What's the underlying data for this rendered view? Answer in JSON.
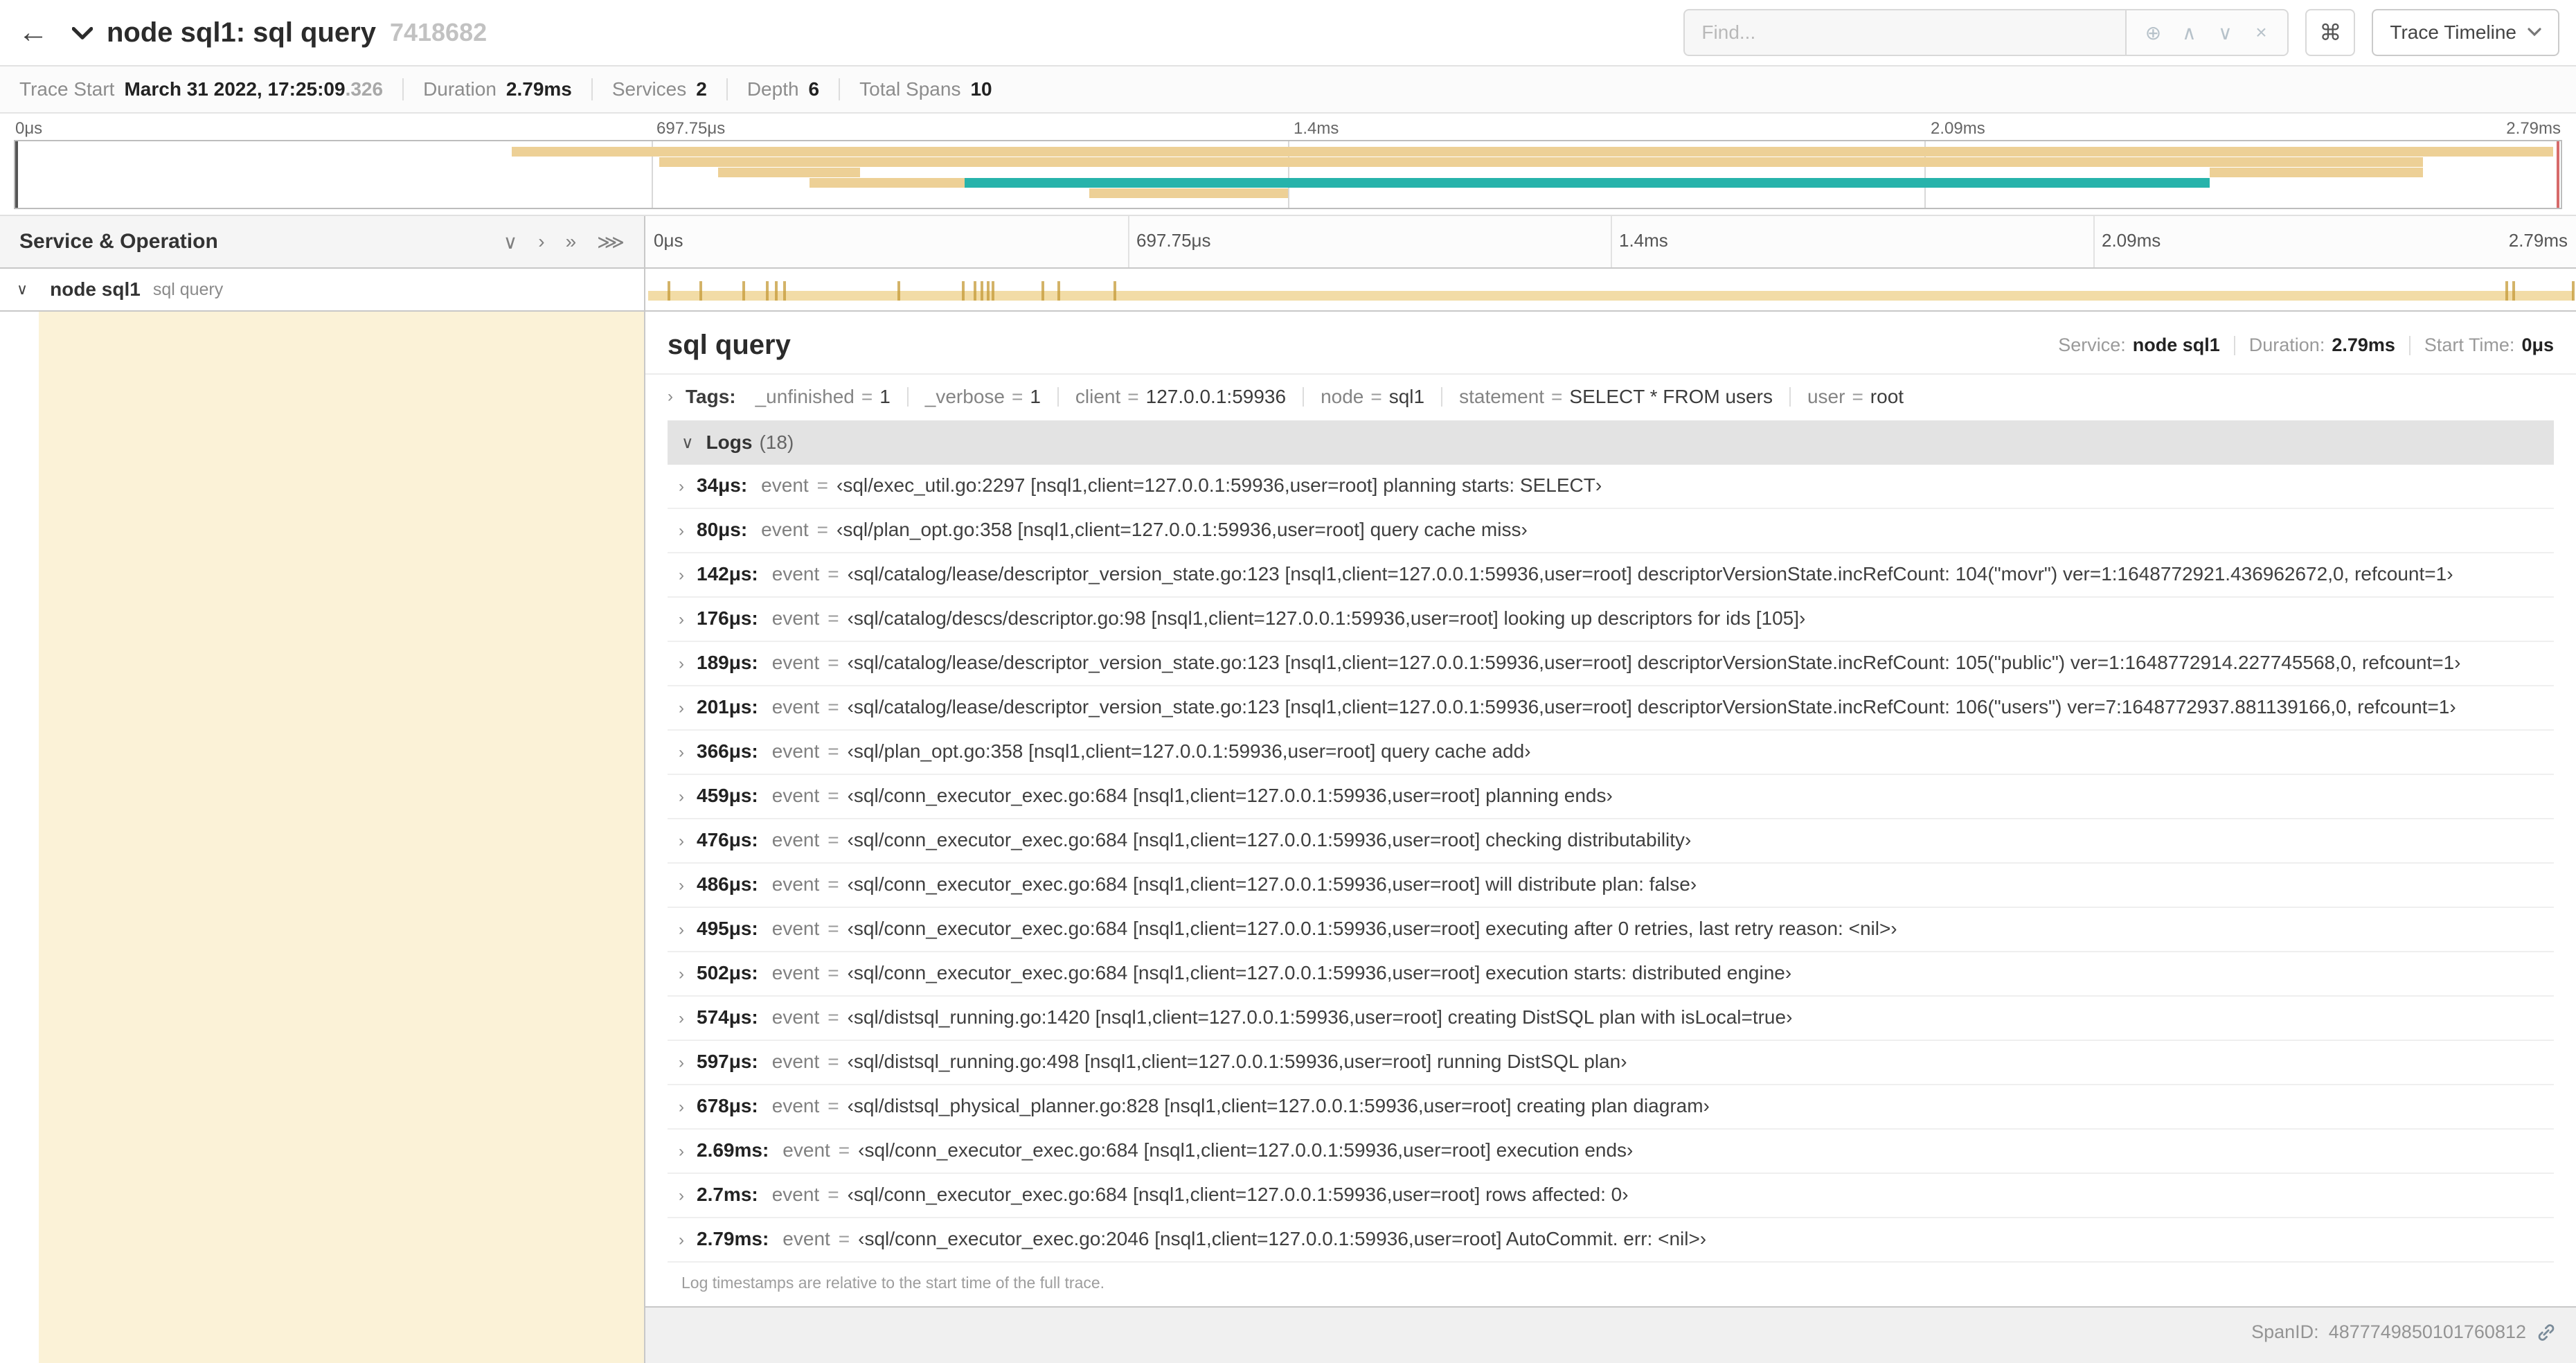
{
  "icons": {
    "back": "←",
    "chevron_right": "›",
    "chevron_down": "∨",
    "double_chevron_right": "»",
    "triple_chevron_right": "⋙",
    "circle_plus": "⊕",
    "chevron_up_small": "∧",
    "chevron_down_small": "∨",
    "close": "×",
    "command": "⌘"
  },
  "colors": {
    "span_tan": "#f2dca6",
    "minimap_tan": "#edd096",
    "teal": "#27b3ab",
    "detail_highlight": "#fbf2d7"
  },
  "header": {
    "title": "node sql1: sql query",
    "trace_id": "7418682",
    "find_placeholder": "Find...",
    "view_dropdown": "Trace Timeline"
  },
  "summary": {
    "trace_start_label": "Trace Start",
    "trace_start_value": "March 31 2022, 17:25:09",
    "trace_start_suffix": ".326",
    "duration_label": "Duration",
    "duration_value": "2.79ms",
    "services_label": "Services",
    "services_value": "2",
    "depth_label": "Depth",
    "depth_value": "6",
    "total_spans_label": "Total Spans",
    "total_spans_value": "10"
  },
  "timeline": {
    "ticks": [
      "0μs",
      "697.75μs",
      "1.4ms",
      "2.09ms",
      "2.79ms"
    ],
    "duration_us": 2790
  },
  "minimap": {
    "bars": [
      {
        "row": 0,
        "left": 19.5,
        "width": 80.2,
        "color": "tan"
      },
      {
        "row": 1,
        "left": 25.3,
        "width": 69.3,
        "color": "tan"
      },
      {
        "row": 2,
        "left": 27.6,
        "width": 5.6,
        "color": "tan"
      },
      {
        "row": 2,
        "left": 86.2,
        "width": 8.4,
        "color": "tan"
      },
      {
        "row": 3,
        "left": 31.2,
        "width": 6.1,
        "color": "tan"
      },
      {
        "row": 3,
        "left": 37.3,
        "width": 48.9,
        "color": "teal"
      },
      {
        "row": 4,
        "left": 42.2,
        "width": 7.8,
        "color": "tan"
      }
    ]
  },
  "left_panel": {
    "header": "Service & Operation",
    "row": {
      "service": "node sql1",
      "operation": "sql query"
    }
  },
  "detail": {
    "title": "sql query",
    "service_label": "Service:",
    "service_value": "node sql1",
    "duration_label": "Duration:",
    "duration_value": "2.79ms",
    "start_label": "Start Time:",
    "start_value": "0μs",
    "tags_label": "Tags:",
    "tags": [
      {
        "key": "_unfinished",
        "value": "1"
      },
      {
        "key": "_verbose",
        "value": "1"
      },
      {
        "key": "client",
        "value": "127.0.0.1:59936"
      },
      {
        "key": "node",
        "value": "sql1"
      },
      {
        "key": "statement",
        "value": "SELECT * FROM users"
      },
      {
        "key": "user",
        "value": "root"
      }
    ],
    "logs_label": "Logs",
    "logs_count": "(18)",
    "logs": [
      {
        "time": "34μs",
        "field": "event",
        "value": "‹sql/exec_util.go:2297 [nsql1,client=127.0.0.1:59936,user=root] planning starts: SELECT›"
      },
      {
        "time": "80μs",
        "field": "event",
        "value": "‹sql/plan_opt.go:358 [nsql1,client=127.0.0.1:59936,user=root] query cache miss›"
      },
      {
        "time": "142μs",
        "field": "event",
        "value": "‹sql/catalog/lease/descriptor_version_state.go:123 [nsql1,client=127.0.0.1:59936,user=root] descriptorVersionState.incRefCount: 104(\"movr\") ver=1:1648772921.436962672,0, refcount=1›"
      },
      {
        "time": "176μs",
        "field": "event",
        "value": "‹sql/catalog/descs/descriptor.go:98 [nsql1,client=127.0.0.1:59936,user=root] looking up descriptors for ids [105]›"
      },
      {
        "time": "189μs",
        "field": "event",
        "value": "‹sql/catalog/lease/descriptor_version_state.go:123 [nsql1,client=127.0.0.1:59936,user=root] descriptorVersionState.incRefCount: 105(\"public\") ver=1:1648772914.227745568,0, refcount=1›"
      },
      {
        "time": "201μs",
        "field": "event",
        "value": "‹sql/catalog/lease/descriptor_version_state.go:123 [nsql1,client=127.0.0.1:59936,user=root] descriptorVersionState.incRefCount: 106(\"users\") ver=7:1648772937.881139166,0, refcount=1›"
      },
      {
        "time": "366μs",
        "field": "event",
        "value": "‹sql/plan_opt.go:358 [nsql1,client=127.0.0.1:59936,user=root] query cache add›"
      },
      {
        "time": "459μs",
        "field": "event",
        "value": "‹sql/conn_executor_exec.go:684 [nsql1,client=127.0.0.1:59936,user=root] planning ends›"
      },
      {
        "time": "476μs",
        "field": "event",
        "value": "‹sql/conn_executor_exec.go:684 [nsql1,client=127.0.0.1:59936,user=root] checking distributability›"
      },
      {
        "time": "486μs",
        "field": "event",
        "value": "‹sql/conn_executor_exec.go:684 [nsql1,client=127.0.0.1:59936,user=root] will distribute plan: false›"
      },
      {
        "time": "495μs",
        "field": "event",
        "value": "‹sql/conn_executor_exec.go:684 [nsql1,client=127.0.0.1:59936,user=root] executing after 0 retries, last retry reason: <nil>›"
      },
      {
        "time": "502μs",
        "field": "event",
        "value": "‹sql/conn_executor_exec.go:684 [nsql1,client=127.0.0.1:59936,user=root] execution starts: distributed engine›"
      },
      {
        "time": "574μs",
        "field": "event",
        "value": "‹sql/distsql_running.go:1420 [nsql1,client=127.0.0.1:59936,user=root] creating DistSQL plan with isLocal=true›"
      },
      {
        "time": "597μs",
        "field": "event",
        "value": "‹sql/distsql_running.go:498 [nsql1,client=127.0.0.1:59936,user=root] running DistSQL plan›"
      },
      {
        "time": "678μs",
        "field": "event",
        "value": "‹sql/distsql_physical_planner.go:828 [nsql1,client=127.0.0.1:59936,user=root] creating plan diagram›"
      },
      {
        "time": "2.69ms",
        "field": "event",
        "value": "‹sql/conn_executor_exec.go:684 [nsql1,client=127.0.0.1:59936,user=root] execution ends›"
      },
      {
        "time": "2.7ms",
        "field": "event",
        "value": "‹sql/conn_executor_exec.go:684 [nsql1,client=127.0.0.1:59936,user=root] rows affected: 0›"
      },
      {
        "time": "2.79ms",
        "field": "event",
        "value": "‹sql/conn_executor_exec.go:2046 [nsql1,client=127.0.0.1:59936,user=root] AutoCommit. err: <nil>›"
      }
    ],
    "logs_footer": "Log timestamps are relative to the start time of the full trace.",
    "span_id_label": "SpanID:",
    "span_id": "4877749850101760812"
  }
}
